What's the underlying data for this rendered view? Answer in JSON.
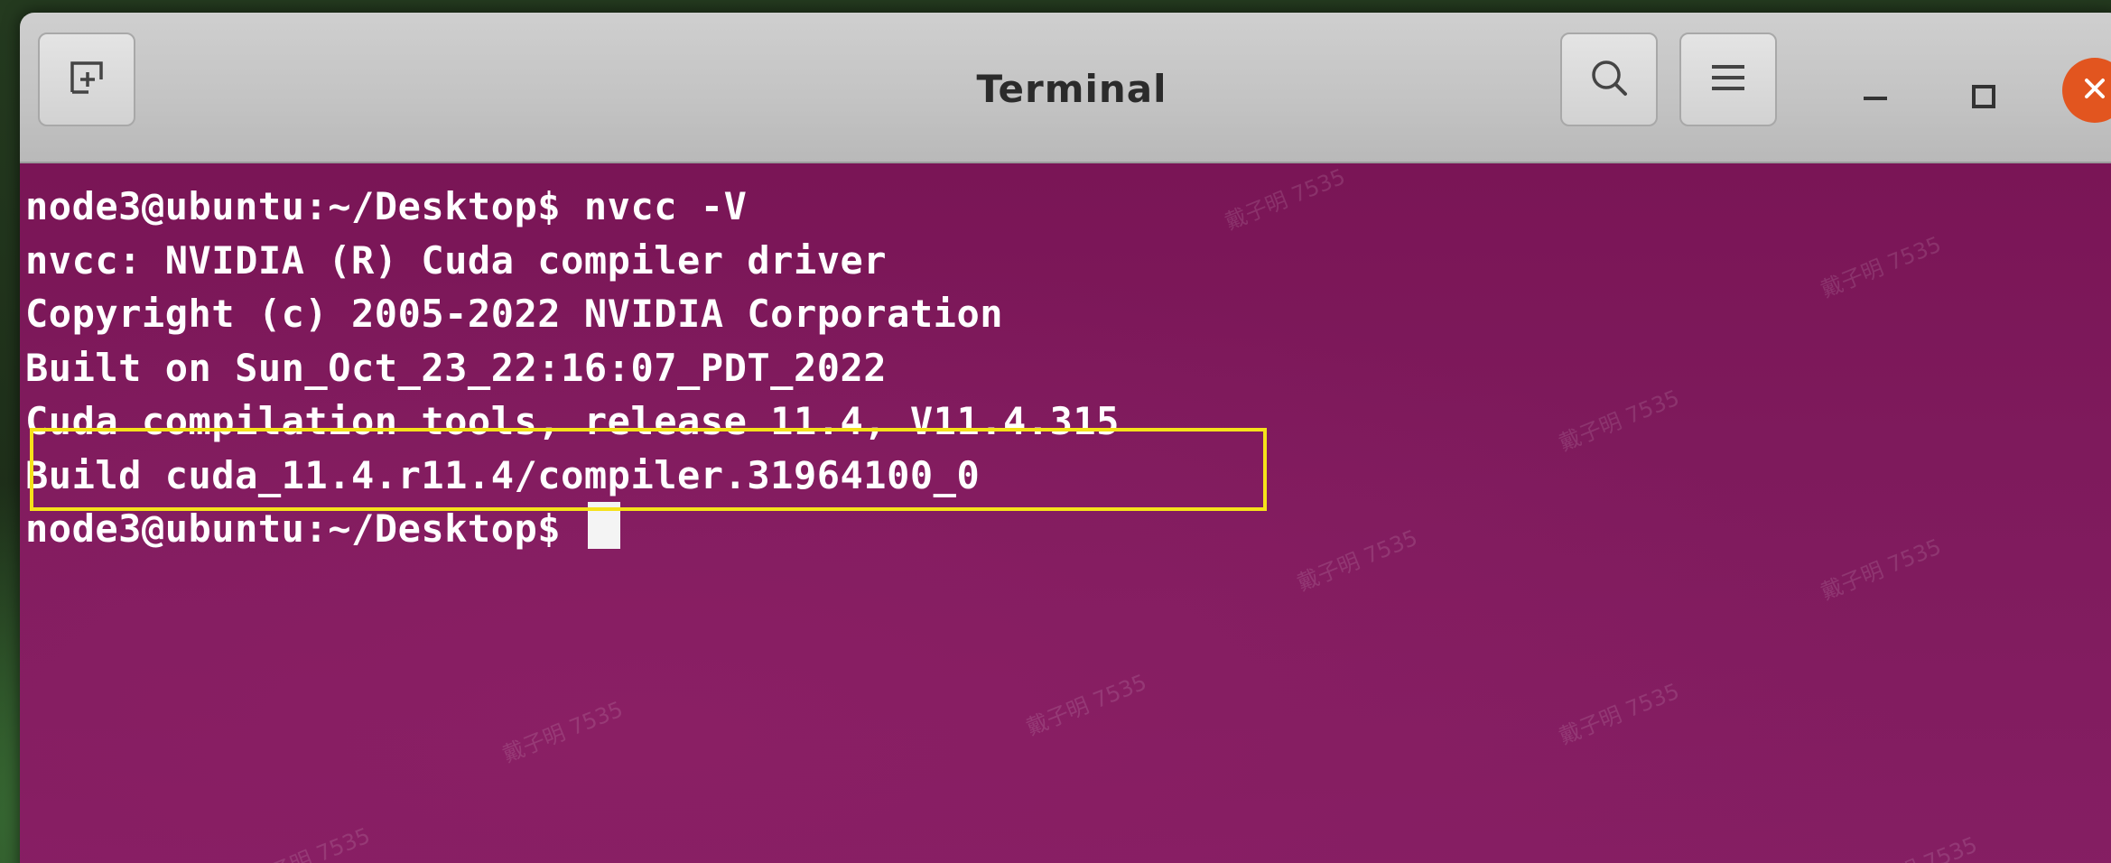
{
  "window": {
    "title": "Terminal"
  },
  "titlebar": {
    "new_tab_icon": "new-tab-icon",
    "search_icon": "search-icon",
    "menu_icon": "hamburger-menu-icon",
    "minimize_icon": "minimize-icon",
    "maximize_icon": "maximize-icon",
    "close_icon": "close-icon"
  },
  "terminal": {
    "lines": [
      "node3@ubuntu:~/Desktop$ nvcc -V",
      "nvcc: NVIDIA (R) Cuda compiler driver",
      "Copyright (c) 2005-2022 NVIDIA Corporation",
      "Built on Sun_Oct_23_22:16:07_PDT_2022",
      "Cuda compilation tools, release 11.4, V11.4.315",
      "Build cuda_11.4.r11.4/compiler.31964100_0",
      "node3@ubuntu:~/Desktop$ "
    ],
    "highlighted_line": "Build cuda_11.4.r11.4/compiler.31964100_0"
  },
  "watermark": {
    "text": "戴子明 7535"
  },
  "colors": {
    "terminal_bg": "#7e1a5c",
    "titlebar_bg": "#c6c6c6",
    "close_button": "#e2551f",
    "highlight_border": "#f5e21a",
    "text": "#ffffff"
  }
}
